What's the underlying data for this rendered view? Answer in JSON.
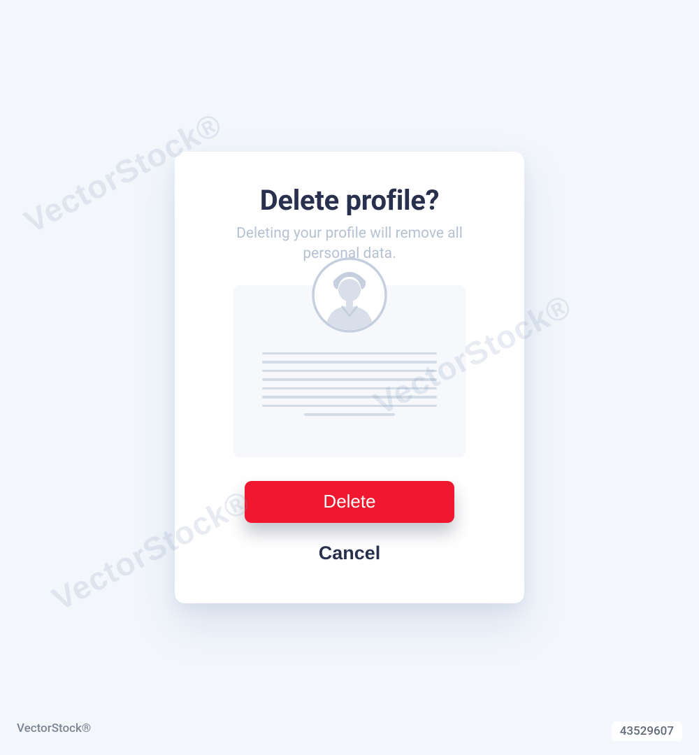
{
  "modal": {
    "title": "Delete profile?",
    "subtitle": "Deleting your profile will remove all personal data.",
    "delete_label": "Delete",
    "cancel_label": "Cancel"
  },
  "watermark": {
    "text": "VectorStock®"
  },
  "footer": {
    "brand": "VectorStock®",
    "id": "43529607"
  },
  "colors": {
    "accent": "#ef182e",
    "heading": "#29304d",
    "muted": "#b6c1d2",
    "bg": "#f3f7fc"
  }
}
